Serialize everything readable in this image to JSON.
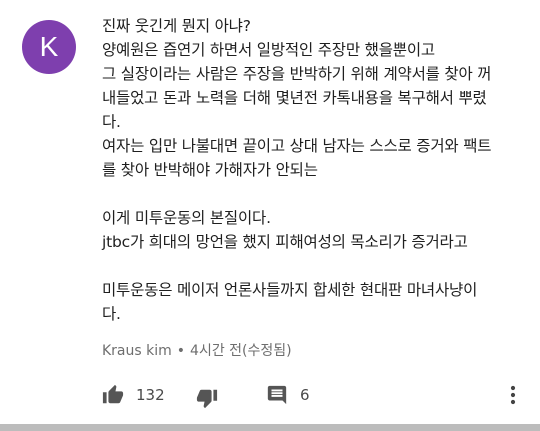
{
  "comment": {
    "avatar_letter": "K",
    "avatar_color": "#7e3fae",
    "lines": [
      "진짜 웃긴게 뭔지 아냐?",
      "양예원은 즙연기 하면서 일방적인 주장만 했을뿐이고",
      "그 실장이라는 사람은 주장을 반박하기 위해 계약서를 찾아 꺼",
      "내들었고 돈과 노력을 더해 몇년전 카톡내용을 복구해서 뿌렸",
      "다.",
      "여자는 입만 나불대면 끝이고 상대 남자는 스스로 증거와 팩트",
      "를 찾아 반박해야 가해자가 안되는",
      "",
      "이게 미투운동의 본질이다.",
      "jtbc가 희대의 망언을 했지 피해여성의 목소리가 증거라고",
      "",
      "미투운동은 메이저 언론사들까지 합세한 현대판 마녀사냥이",
      "다."
    ],
    "author": "Kraus kim",
    "separator": "•",
    "time": "4시간 전(수정됨)",
    "like_count": "132",
    "reply_count": "6",
    "icons": {
      "like": "thumbs-up-icon",
      "dislike": "thumbs-down-icon",
      "reply": "comment-icon",
      "more": "more-vertical-icon"
    }
  }
}
